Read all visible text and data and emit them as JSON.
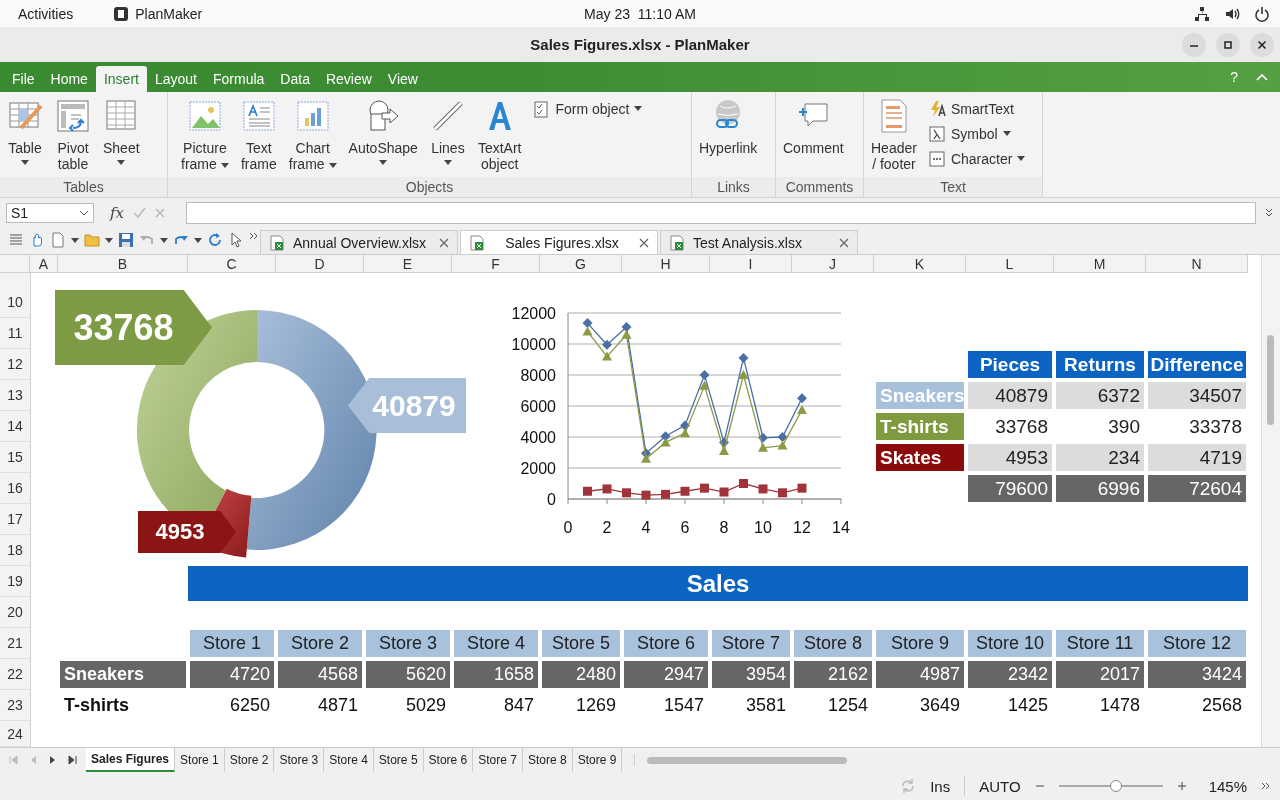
{
  "topbar": {
    "activities": "Activities",
    "app": "PlanMaker",
    "clock": "May 23  11:10 AM"
  },
  "window": {
    "title": "Sales Figures.xlsx - PlanMaker"
  },
  "menu_tabs": [
    {
      "label": "File",
      "selected": false
    },
    {
      "label": "Home",
      "selected": false
    },
    {
      "label": "Insert",
      "selected": true
    },
    {
      "label": "Layout",
      "selected": false
    },
    {
      "label": "Formula",
      "selected": false
    },
    {
      "label": "Data",
      "selected": false
    },
    {
      "label": "Review",
      "selected": false
    },
    {
      "label": "View",
      "selected": false
    }
  ],
  "help": "?",
  "ribbon_groups": [
    {
      "title": "Tables",
      "buttons": [
        {
          "kind": "large",
          "label": "Table",
          "dropdown": true
        },
        {
          "kind": "large",
          "label": "Pivot\ntable",
          "dropdown": false
        },
        {
          "kind": "large",
          "label": "Sheet",
          "dropdown": true
        }
      ]
    },
    {
      "title": "Objects",
      "buttons": [
        {
          "kind": "large",
          "label": "Picture\nframe",
          "dropdown": true
        },
        {
          "kind": "large",
          "label": "Text\nframe",
          "dropdown": false
        },
        {
          "kind": "large",
          "label": "Chart\nframe",
          "dropdown": true
        },
        {
          "kind": "large",
          "label": "AutoShape",
          "dropdown": true
        },
        {
          "kind": "large",
          "label": "Lines",
          "dropdown": true
        },
        {
          "kind": "large",
          "label": "TextArt\nobject",
          "dropdown": false
        },
        {
          "kind": "small",
          "label": "Form object",
          "dropdown": true
        }
      ]
    },
    {
      "title": "Links",
      "buttons": [
        {
          "kind": "large",
          "label": "Hyperlink",
          "dropdown": false
        }
      ]
    },
    {
      "title": "Comments",
      "buttons": [
        {
          "kind": "large",
          "label": "Comment",
          "dropdown": false
        }
      ]
    },
    {
      "title": "Text",
      "buttons": [
        {
          "kind": "large",
          "label": "Header\n/ footer",
          "dropdown": false
        },
        {
          "kind": "small",
          "label": "SmartText",
          "dropdown": false
        },
        {
          "kind": "small",
          "label": "Symbol",
          "dropdown": true
        },
        {
          "kind": "small",
          "label": "Character",
          "dropdown": true
        }
      ]
    }
  ],
  "formula_bar": {
    "cell_ref": "S1",
    "function_button": "fx"
  },
  "doc_tabs": [
    {
      "label": "Annual Overview.xlsx",
      "selected": false
    },
    {
      "label": "Sales Figures.xlsx",
      "selected": true
    },
    {
      "label": "Test Analysis.xlsx",
      "selected": false
    }
  ],
  "sheet": {
    "columns": [
      "A",
      "B",
      "C",
      "D",
      "E",
      "F",
      "G",
      "H",
      "I",
      "J",
      "K",
      "L",
      "M",
      "N"
    ],
    "rows": [
      "10",
      "11",
      "12",
      "13",
      "14",
      "15",
      "16",
      "17",
      "18",
      "19",
      "20",
      "21",
      "22",
      "23",
      "24"
    ],
    "donut_chart": {
      "chart_data": {
        "type": "donut",
        "values": [
          40879,
          33768,
          4953
        ],
        "data_labels": true
      }
    },
    "line_chart": {
      "chart_data": {
        "type": "line",
        "x": [
          1,
          2,
          3,
          4,
          5,
          6,
          7,
          8,
          9,
          10,
          11,
          12
        ],
        "grid": true,
        "xlim": [
          0,
          14
        ],
        "ylim": [
          0,
          12000
        ],
        "xticks": [
          0,
          2,
          4,
          6,
          8,
          10,
          12,
          14
        ],
        "yticks": [
          0,
          2000,
          4000,
          6000,
          8000,
          10000,
          12000
        ],
        "series": [
          {
            "color": "#4a6fa5",
            "marker": "diamond",
            "values": [
              11350,
              9950,
              11100,
              2950,
              4050,
              4750,
              8000,
              3650,
              9100,
              3950,
              4000,
              6500
            ]
          },
          {
            "color": "#8c9a48",
            "marker": "triangle",
            "values": [
              10800,
              9200,
              10600,
              2600,
              3650,
              4250,
              7300,
              3100,
              8000,
              3300,
              3450,
              5750
            ]
          },
          {
            "color": "#a0343a",
            "marker": "square",
            "values": [
              500,
              650,
              400,
              250,
              300,
              500,
              700,
              450,
              1000,
              650,
              400,
              700
            ]
          }
        ]
      }
    },
    "summary_table": {
      "columns": [
        "Pieces",
        "Returns",
        "Difference"
      ],
      "rows": [
        {
          "label": "Sneakers",
          "color": "#a9c0da",
          "values": [
            "40879",
            "6372",
            "34507"
          ]
        },
        {
          "label": "T-shirts",
          "color": "#7f9a3f",
          "values": [
            "33768",
            "390",
            "33378"
          ]
        },
        {
          "label": "Skates",
          "color": "#8b0a0a",
          "values": [
            "4953",
            "234",
            "4719"
          ]
        }
      ],
      "totals": [
        "79600",
        "6996",
        "72604"
      ]
    },
    "banner": "Sales",
    "store_table": {
      "columns": [
        "Store 1",
        "Store 2",
        "Store 3",
        "Store 4",
        "Store 5",
        "Store 6",
        "Store 7",
        "Store 8",
        "Store 9",
        "Store 10",
        "Store 11",
        "Store 12"
      ],
      "rows": [
        {
          "label": "Sneakers",
          "shaded": true,
          "values": [
            "4720",
            "4568",
            "5620",
            "1658",
            "2480",
            "2947",
            "3954",
            "2162",
            "4987",
            "2342",
            "2017",
            "3424"
          ]
        },
        {
          "label": "T-shirts",
          "shaded": false,
          "values": [
            "6250",
            "4871",
            "5029",
            "847",
            "1269",
            "1547",
            "3581",
            "1254",
            "3649",
            "1425",
            "1478",
            "2568"
          ]
        }
      ]
    }
  },
  "sheet_tabs": [
    {
      "label": "Sales Figures",
      "selected": true
    },
    {
      "label": "Store 1",
      "selected": false
    },
    {
      "label": "Store 2",
      "selected": false
    },
    {
      "label": "Store 3",
      "selected": false
    },
    {
      "label": "Store 4",
      "selected": false
    },
    {
      "label": "Store 5",
      "selected": false
    },
    {
      "label": "Store 6",
      "selected": false
    },
    {
      "label": "Store 7",
      "selected": false
    },
    {
      "label": "Store 8",
      "selected": false
    },
    {
      "label": "Store 9",
      "selected": false
    }
  ],
  "status": {
    "mode": "Ins",
    "calc": "AUTO",
    "zoom_slider": {
      "level": 0.55
    },
    "zoom": "145%"
  }
}
